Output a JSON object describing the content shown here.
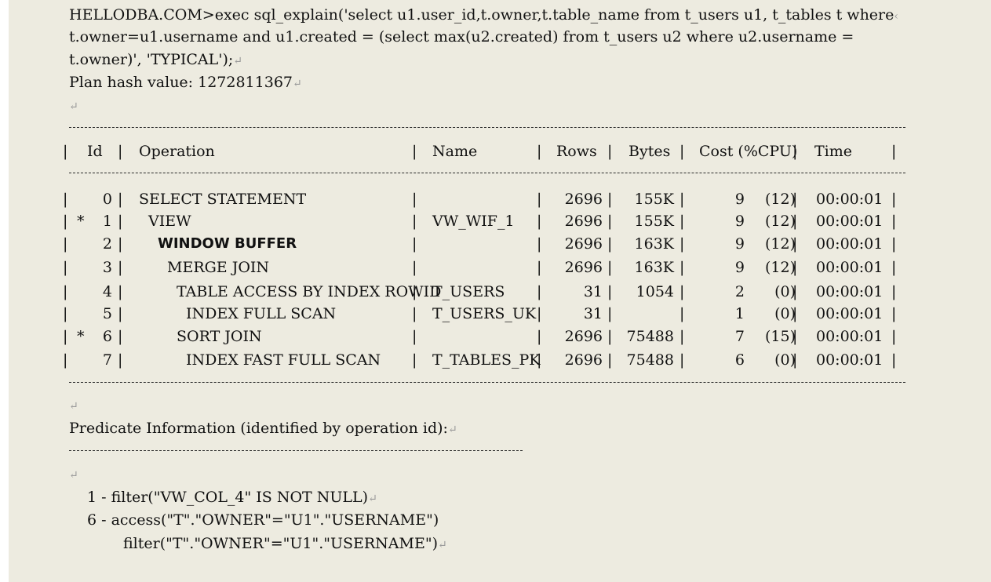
{
  "command": {
    "line1": "HELLODBA.COM>exec sql_explain('select u1.user_id,t.owner,t.table_name from t_users u1, t_tables t where",
    "line2": "t.owner=u1.username and u1.created = (select max(u2.created) from t_users u2 where u2.username =",
    "line3": "t.owner)', 'TYPICAL');"
  },
  "plan_hash": "Plan hash value: 1272811367",
  "columns": {
    "id": "Id",
    "operation": "Operation",
    "name": "Name",
    "rows": "Rows",
    "bytes": "Bytes",
    "cost": "Cost (%CPU)",
    "time": "Time"
  },
  "rows": [
    {
      "mark": "",
      "id": "0",
      "operation": "SELECT STATEMENT",
      "name": "",
      "rows": "2696",
      "bytes": "155K",
      "cost": "9",
      "cpu": "(12)",
      "time": "00:00:01"
    },
    {
      "mark": "*",
      "id": "1",
      "operation": "VIEW",
      "name": "VW_WIF_1",
      "rows": "2696",
      "bytes": "155K",
      "cost": "9",
      "cpu": "(12)",
      "time": "00:00:01"
    },
    {
      "mark": "",
      "id": "2",
      "operation": "WINDOW BUFFER",
      "name": "",
      "rows": "2696",
      "bytes": "163K",
      "cost": "9",
      "cpu": "(12)",
      "time": "00:00:01"
    },
    {
      "mark": "",
      "id": "3",
      "operation": "MERGE JOIN",
      "name": "",
      "rows": "2696",
      "bytes": "163K",
      "cost": "9",
      "cpu": "(12)",
      "time": "00:00:01"
    },
    {
      "mark": "",
      "id": "4",
      "operation": "TABLE ACCESS BY INDEX ROWID",
      "name": "T_USERS",
      "rows": "31",
      "bytes": "1054",
      "cost": "2",
      "cpu": "(0)",
      "time": "00:00:01"
    },
    {
      "mark": "",
      "id": "5",
      "operation": "INDEX FULL SCAN",
      "name": "T_USERS_UK",
      "rows": "31",
      "bytes": "",
      "cost": "1",
      "cpu": "(0)",
      "time": "00:00:01"
    },
    {
      "mark": "*",
      "id": "6",
      "operation": "SORT JOIN",
      "name": "",
      "rows": "2696",
      "bytes": "75488",
      "cost": "7",
      "cpu": "(15)",
      "time": "00:00:01"
    },
    {
      "mark": "",
      "id": "7",
      "operation": "INDEX FAST FULL SCAN",
      "name": "T_TABLES_PK",
      "rows": "2696",
      "bytes": "75488",
      "cost": "6",
      "cpu": "(0)",
      "time": "00:00:01"
    }
  ],
  "predicate": {
    "title": "Predicate Information (identified by operation id):",
    "line1": "1 - filter(\"VW_COL_4\" IS NOT NULL)",
    "line2": "6 - access(\"T\".\"OWNER\"=\"U1\".\"USERNAME\")",
    "line3": "filter(\"T\".\"OWNER\"=\"U1\".\"USERNAME\")"
  },
  "return_mark": "↵"
}
